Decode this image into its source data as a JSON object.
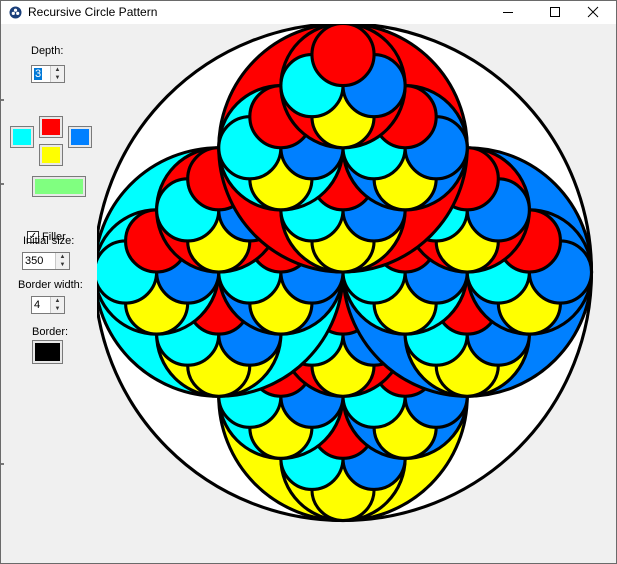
{
  "window": {
    "title": "Recursive Circle Pattern",
    "titlebar_icons": [
      "app-icon",
      "minimize-icon",
      "maximize-icon",
      "close-icon"
    ]
  },
  "controls": {
    "depth_label": "Depth:",
    "depth_value": "3",
    "colors": {
      "top": "#ff0000",
      "left": "#00ffff",
      "right": "#0080ff",
      "bottom": "#ffff00",
      "filler": "#80ff80",
      "border": "#000000"
    },
    "filler_checkbox_label": "Filler",
    "filler_checked": true,
    "filler_check_glyph": "✓",
    "initial_size_label": "Initial size:",
    "initial_size_value": "350",
    "border_width_label": "Border width:",
    "border_width_value": "4",
    "border_label": "Border:"
  },
  "pattern": {
    "depth": 3,
    "initial_size": 350,
    "border_width": 4,
    "filler_enabled": true
  }
}
